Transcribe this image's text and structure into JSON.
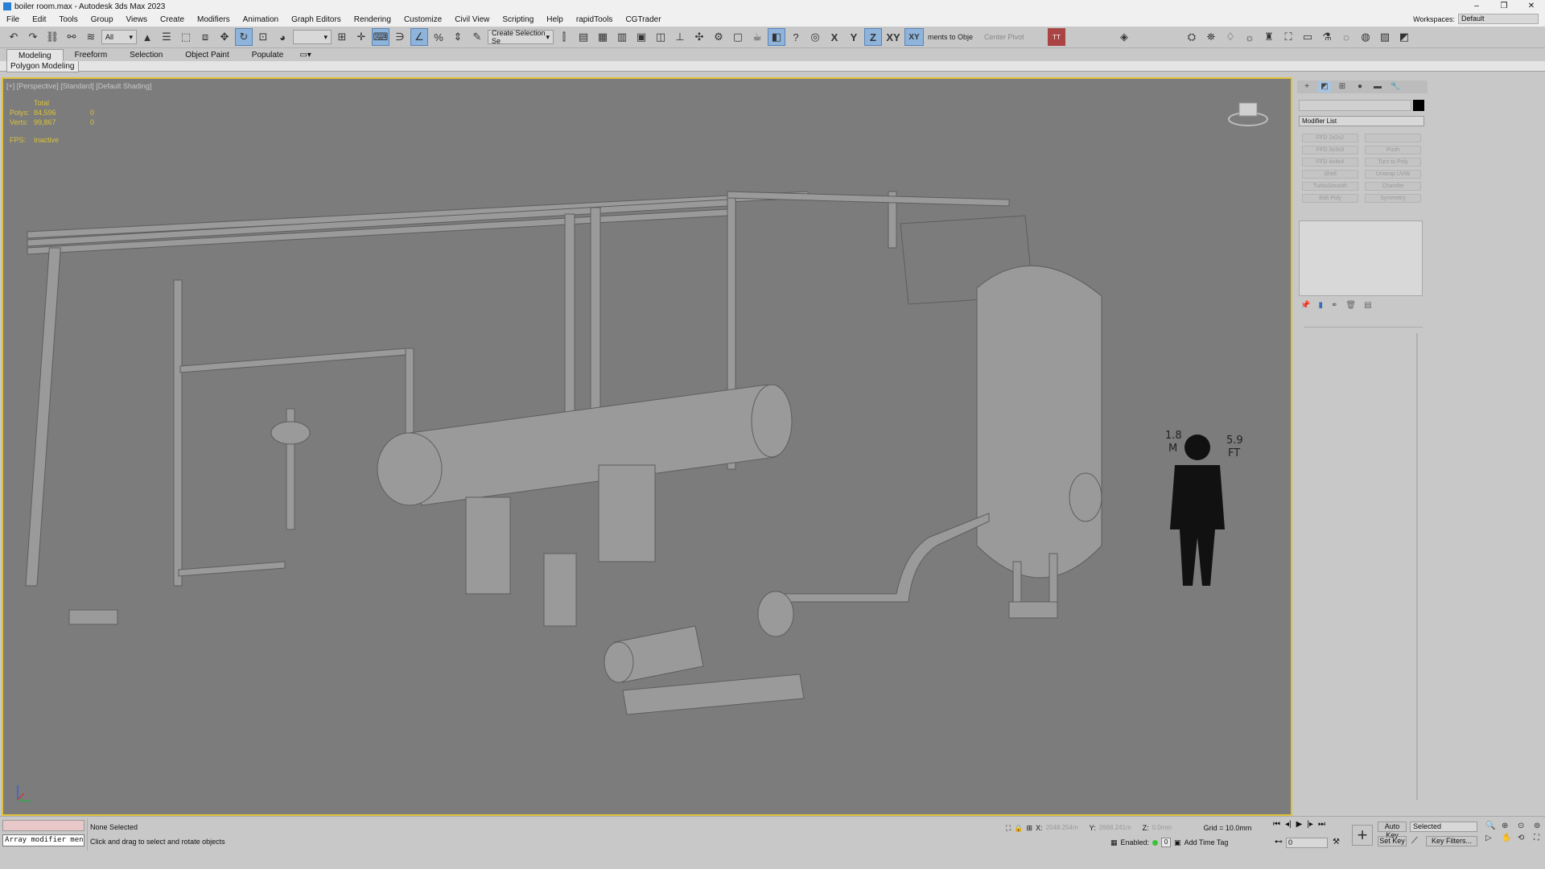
{
  "window": {
    "title": "boiler room.max - Autodesk 3ds Max 2023",
    "minimize": "–",
    "maximize": "❐",
    "close": "✕"
  },
  "menu": {
    "items": [
      "File",
      "Edit",
      "Tools",
      "Group",
      "Views",
      "Create",
      "Modifiers",
      "Animation",
      "Graph Editors",
      "Rendering",
      "Customize",
      "Civil View",
      "Scripting",
      "Help",
      "rapidTools",
      "CGTrader"
    ],
    "workspaces_label": "Workspaces:",
    "workspaces_value": "Default"
  },
  "toolbar": {
    "selection_filter": "All",
    "named_selection": "Create Selection Se",
    "snap_label": "ments to Obje",
    "pivot_label": "Center Pivot",
    "axis_x": "X",
    "axis_y": "Y",
    "axis_z": "Z",
    "axis_xy": "XY",
    "axis_xy2": "XY"
  },
  "ribbon": {
    "tabs": [
      "Modeling",
      "Freeform",
      "Selection",
      "Object Paint",
      "Populate"
    ],
    "panel": "Polygon Modeling"
  },
  "viewport": {
    "label": "[+] [Perspective] [Standard] [Default Shading]",
    "stats": {
      "header": "Total",
      "polys_label": "Polys:",
      "polys_value": "84,596",
      "polys_sel": "0",
      "verts_label": "Verts:",
      "verts_value": "99,867",
      "verts_sel": "0",
      "fps_label": "FPS:",
      "fps_value": "Inactive"
    },
    "scale_left": "1.8",
    "scale_left_unit": "M",
    "scale_right": "5.9",
    "scale_right_unit": "FT"
  },
  "command_panel": {
    "modifier_list": "Modifier List",
    "modifiers": [
      "FFD 2x2x2",
      "",
      "FFD 3x3x3",
      "Push",
      "FFD 4x4x4",
      "Turn to Poly",
      "Shell",
      "Unwrap UVW",
      "TurboSmooth",
      "Chamfer",
      "Edit Poly",
      "Symmetry"
    ]
  },
  "status": {
    "maxscript_input": "Array modifier men",
    "selection": "None Selected",
    "prompt": "Click and drag to select and rotate objects",
    "x_label": "X:",
    "x_value": "2048.254m",
    "y_label": "Y:",
    "y_value": "2668.241m",
    "z_label": "Z:",
    "z_value": "0.0mm",
    "grid": "Grid = 10.0mm",
    "enabled_label": "Enabled:",
    "add_time_tag": "Add Time Tag",
    "frame_value": "0",
    "auto_key": "Auto Key",
    "set_key": "Set Key",
    "selected": "Selected",
    "key_filters": "Key Filters..."
  }
}
